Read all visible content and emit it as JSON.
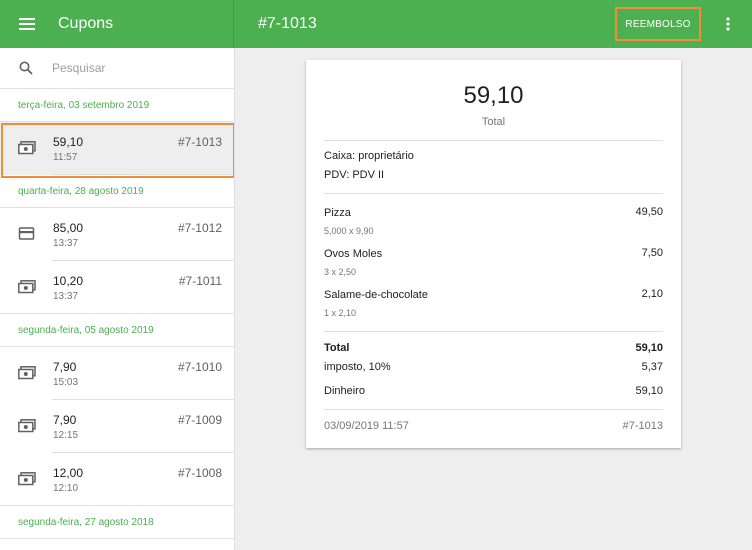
{
  "appbar": {
    "title": "Cupons",
    "receipt_title": "#7-1013",
    "refund_label": "REEMBOLSO"
  },
  "colors": {
    "primary": "#4caf50",
    "highlight": "#f28c38"
  },
  "search": {
    "placeholder": "Pesquisar"
  },
  "groups": [
    {
      "date": "terça-feira, 03 setembro 2019",
      "items": [
        {
          "amount": "59,10",
          "time": "11:57",
          "number": "#7-1013",
          "icon": "cash-icon",
          "selected": true
        }
      ]
    },
    {
      "date": "quarta-feira, 28 agosto 2019",
      "items": [
        {
          "amount": "85,00",
          "time": "13:37",
          "number": "#7-1012",
          "icon": "card-icon"
        },
        {
          "amount": "10,20",
          "time": "13:37",
          "number": "#7-1011",
          "icon": "cash-icon"
        }
      ]
    },
    {
      "date": "segunda-feira, 05 agosto 2019",
      "items": [
        {
          "amount": "7,90",
          "time": "15:03",
          "number": "#7-1010",
          "icon": "cash-icon"
        },
        {
          "amount": "7,90",
          "time": "12:15",
          "number": "#7-1009",
          "icon": "cash-icon"
        },
        {
          "amount": "12,00",
          "time": "12:10",
          "number": "#7-1008",
          "icon": "cash-icon"
        }
      ]
    },
    {
      "date": "segunda-feira, 27 agosto 2018",
      "items": []
    }
  ],
  "receipt": {
    "total": "59,10",
    "total_label": "Total",
    "cashier": "Caixa: proprietário",
    "pos": "PDV: PDV II",
    "lines": [
      {
        "name": "Pizza",
        "detail": "5,000 x 9,90",
        "amount": "49,50"
      },
      {
        "name": "Ovos Moles",
        "detail": "3 x 2,50",
        "amount": "7,50"
      },
      {
        "name": "Salame-de-chocolate",
        "detail": "1 x 2,10",
        "amount": "2,10"
      }
    ],
    "total_row_label": "Total",
    "total_row_value": "59,10",
    "tax_label": "imposto,  10%",
    "tax_value": "5,37",
    "payment_label": "Dinheiro",
    "payment_value": "59,10",
    "datetime": "03/09/2019 11:57",
    "number": "#7-1013"
  }
}
